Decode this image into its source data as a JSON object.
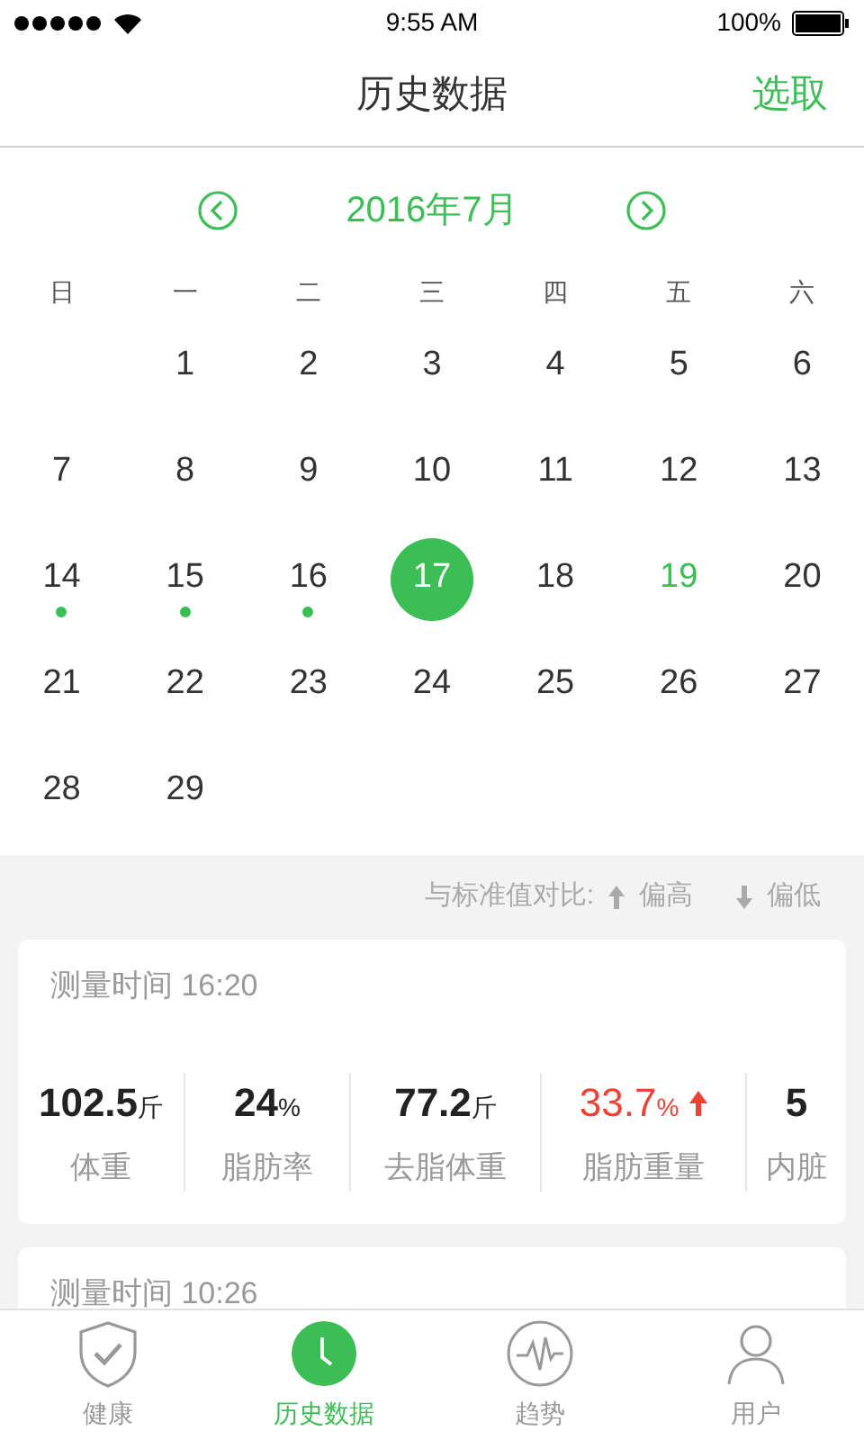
{
  "status_bar": {
    "time": "9:55 AM",
    "battery": "100%"
  },
  "nav": {
    "title": "历史数据",
    "action": "选取"
  },
  "calendar": {
    "month": "2016年7月",
    "weekdays": [
      "日",
      "一",
      "二",
      "三",
      "四",
      "五",
      "六"
    ],
    "weeks": [
      [
        {
          "kind": "blank"
        },
        {
          "kind": "day",
          "label": "1",
          "selected": false,
          "record": false,
          "today": false
        },
        {
          "kind": "day",
          "label": "2",
          "selected": false,
          "record": false,
          "today": false
        },
        {
          "kind": "day",
          "label": "3",
          "selected": false,
          "record": false,
          "today": false
        },
        {
          "kind": "day",
          "label": "4",
          "selected": false,
          "record": false,
          "today": false
        },
        {
          "kind": "day",
          "label": "5",
          "selected": false,
          "record": false,
          "today": false
        },
        {
          "kind": "day",
          "label": "6",
          "selected": false,
          "record": false,
          "today": false
        }
      ],
      [
        {
          "kind": "day",
          "label": "7",
          "selected": false,
          "record": false,
          "today": false
        },
        {
          "kind": "day",
          "label": "8",
          "selected": false,
          "record": false,
          "today": false
        },
        {
          "kind": "day",
          "label": "9",
          "selected": false,
          "record": false,
          "today": false
        },
        {
          "kind": "day",
          "label": "10",
          "selected": false,
          "record": false,
          "today": false
        },
        {
          "kind": "day",
          "label": "11",
          "selected": false,
          "record": false,
          "today": false
        },
        {
          "kind": "day",
          "label": "12",
          "selected": false,
          "record": false,
          "today": false
        },
        {
          "kind": "day",
          "label": "13",
          "selected": false,
          "record": false,
          "today": false
        }
      ],
      [
        {
          "kind": "day",
          "label": "14",
          "selected": false,
          "record": true,
          "today": false
        },
        {
          "kind": "day",
          "label": "15",
          "selected": false,
          "record": true,
          "today": false
        },
        {
          "kind": "day",
          "label": "16",
          "selected": false,
          "record": true,
          "today": false
        },
        {
          "kind": "day",
          "label": "17",
          "selected": true,
          "record": false,
          "today": false
        },
        {
          "kind": "day",
          "label": "18",
          "selected": false,
          "record": false,
          "today": false
        },
        {
          "kind": "day",
          "label": "19",
          "selected": false,
          "record": false,
          "today": true
        },
        {
          "kind": "day",
          "label": "20",
          "selected": false,
          "record": false,
          "today": false
        }
      ],
      [
        {
          "kind": "day",
          "label": "21",
          "selected": false,
          "record": false,
          "today": false
        },
        {
          "kind": "day",
          "label": "22",
          "selected": false,
          "record": false,
          "today": false
        },
        {
          "kind": "day",
          "label": "23",
          "selected": false,
          "record": false,
          "today": false
        },
        {
          "kind": "day",
          "label": "24",
          "selected": false,
          "record": false,
          "today": false
        },
        {
          "kind": "day",
          "label": "25",
          "selected": false,
          "record": false,
          "today": false
        },
        {
          "kind": "day",
          "label": "26",
          "selected": false,
          "record": false,
          "today": false
        },
        {
          "kind": "day",
          "label": "27",
          "selected": false,
          "record": false,
          "today": false
        }
      ],
      [
        {
          "kind": "day",
          "label": "28",
          "selected": false,
          "record": false,
          "today": false
        },
        {
          "kind": "day",
          "label": "29",
          "selected": false,
          "record": false,
          "today": false
        }
      ]
    ]
  },
  "legend": {
    "label": "与标准值对比:",
    "high": "偏高",
    "low": "偏低"
  },
  "records": [
    {
      "time": "测量时间 16:20",
      "metrics": [
        {
          "value": "102.5",
          "unit": "斤",
          "label": "体重",
          "high": false
        },
        {
          "value": "24",
          "unit": "%",
          "label": "脂肪率",
          "high": false
        },
        {
          "value": "77.2",
          "unit": "斤",
          "label": "去脂体重",
          "high": false
        },
        {
          "value": "33.7",
          "unit": "%",
          "label": "脂肪重量",
          "high": true
        },
        {
          "value": "5",
          "label": "内脏",
          "high": false
        }
      ]
    },
    {
      "time": "测量时间 10:26"
    }
  ],
  "tab_bar": [
    {
      "label": "健康",
      "selected": false
    },
    {
      "label": "历史数据",
      "selected": true
    },
    {
      "label": "趋势",
      "selected": false
    },
    {
      "label": "用户",
      "selected": false
    }
  ]
}
